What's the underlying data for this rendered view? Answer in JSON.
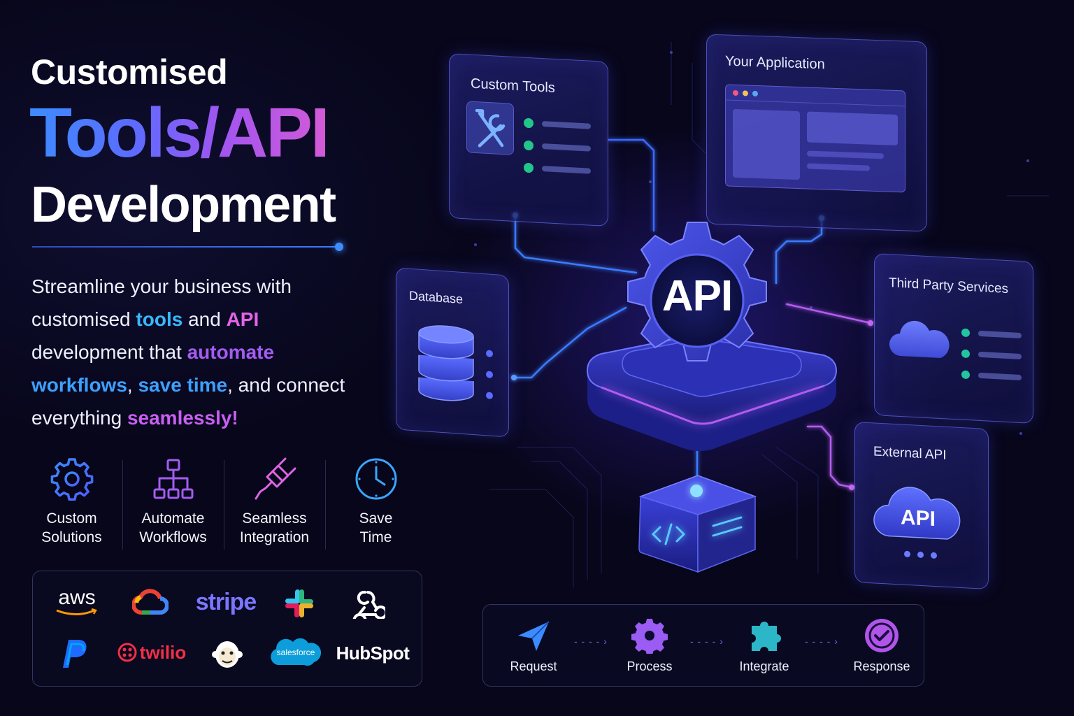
{
  "heading": {
    "line1": "Customised",
    "line2": "Tools/API",
    "line3": "Development"
  },
  "tagline": {
    "t1": "Streamline your business with customised ",
    "h1": "tools",
    "t2": " and ",
    "h2": "API",
    "t3": " development that ",
    "h3": "automate",
    "h4": "workflows",
    "t4": ", ",
    "h5": "save time",
    "t5": ", and connect everything ",
    "h6": "seamlessly!"
  },
  "features": [
    {
      "line1": "Custom",
      "line2": "Solutions",
      "icon": "gear-icon"
    },
    {
      "line1": "Automate",
      "line2": "Workflows",
      "icon": "hierarchy-icon"
    },
    {
      "line1": "Seamless",
      "line2": "Integration",
      "icon": "plug-icon"
    },
    {
      "line1": "Save",
      "line2": "Time",
      "icon": "clock-icon"
    }
  ],
  "logos": {
    "aws": "aws",
    "stripe": "stripe",
    "twilio": "twilio",
    "salesforce": "salesforce",
    "hubspot": "HubSpot"
  },
  "diagram": {
    "custom_tools": "Custom Tools",
    "your_application": "Your Application",
    "database": "Database",
    "third_party": "Third Party Services",
    "external_api": "External API",
    "external_api_badge": "API",
    "hub": "API"
  },
  "flow": [
    {
      "label": "Request",
      "icon": "paper-plane-icon"
    },
    {
      "label": "Process",
      "icon": "gear-icon"
    },
    {
      "label": "Integrate",
      "icon": "puzzle-icon"
    },
    {
      "label": "Response",
      "icon": "check-circle-icon"
    }
  ],
  "colors": {
    "background": "#07061a",
    "accent_blue": "#3d8cff",
    "accent_purple": "#a255f0",
    "accent_pink": "#e463e8",
    "check_green": "#22c58b"
  }
}
